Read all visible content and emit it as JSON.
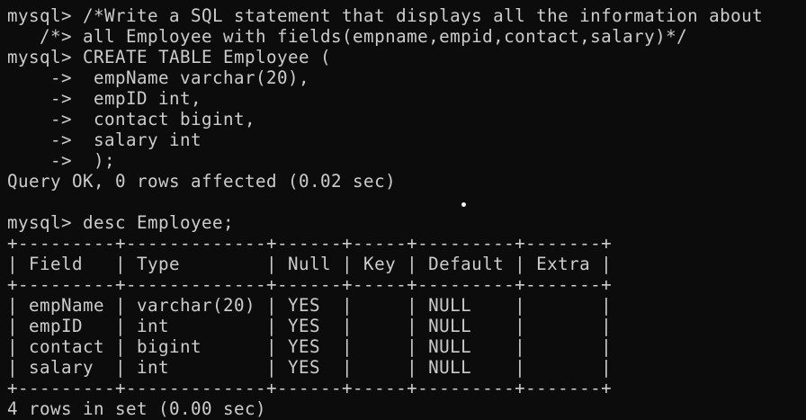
{
  "terminal": {
    "lines": [
      "+---------+-------+",
      "mysql> /*Write a SQL statement that displays all the information about",
      "   /*> all Employee with fields(empname,empid,contact,salary)*/",
      "mysql> CREATE TABLE Employee (",
      "    ->  empName varchar(20),",
      "    ->  empID int,",
      "    ->  contact bigint,",
      "    ->  salary int",
      "    ->  );",
      "Query OK, 0 rows affected (0.02 sec)",
      "",
      "mysql> desc Employee;",
      "+---------+-------------+------+-----+---------+-------+",
      "| Field   | Type        | Null | Key | Default | Extra |",
      "+---------+-------------+------+-----+---------+-------+",
      "| empName | varchar(20) | YES  |     | NULL    |       |",
      "| empID   | int         | YES  |     | NULL    |       |",
      "| contact | bigint      | YES  |     | NULL    |       |",
      "| salary  | int         | YES  |     | NULL    |       |",
      "+---------+-------------+------+-----+---------+-------+",
      "4 rows in set (0.00 sec)"
    ]
  }
}
